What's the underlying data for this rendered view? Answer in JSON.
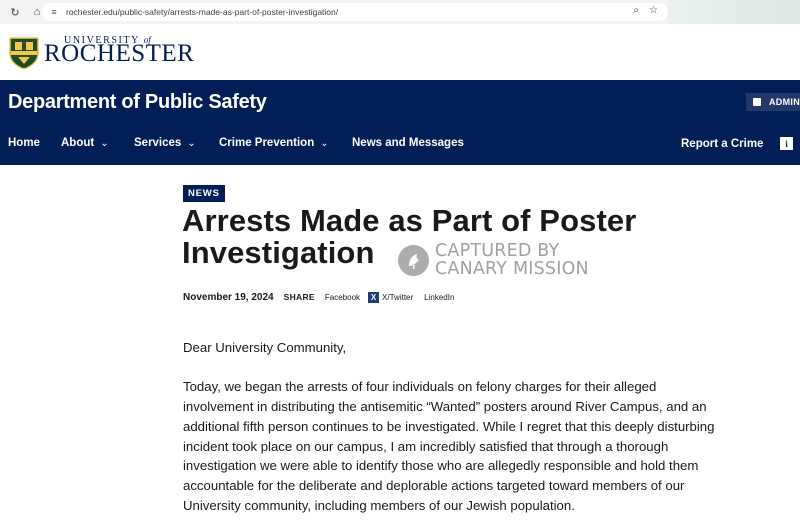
{
  "browser": {
    "url": "rochester.edu/public-safety/arrests-made-as-part-of-poster-investigation/"
  },
  "university": {
    "small": "UNIVERSITY",
    "of": "of",
    "big": "ROCHESTER"
  },
  "department": {
    "title": "Department of Public Safety",
    "admin_label": "ADMINI"
  },
  "nav": {
    "items": [
      {
        "label": "Home"
      },
      {
        "label": "About"
      },
      {
        "label": "Services"
      },
      {
        "label": "Crime Prevention"
      },
      {
        "label": "News and Messages"
      }
    ],
    "report_label": "Report a Crime"
  },
  "article": {
    "badge": "NEWS",
    "title": "Arrests Made as Part of Poster Investigation",
    "date": "November 19, 2024",
    "share_label": "SHARE",
    "social": {
      "facebook": "Facebook",
      "x": "X/Twitter",
      "linkedin": "LinkedIn"
    },
    "greeting": "Dear University Community,",
    "paragraph": "Today, we began the arrests of four individuals on felony charges for their alleged involvement in distributing the antisemitic “Wanted” posters around River Campus, and an additional fifth person continues to be investigated. While I regret that this deeply disturbing incident took place on our campus, I am incredibly satisfied that through a thorough investigation we were able to identify those who are allegedly responsible and hold them accountable for the deliberate and deplorable actions targeted toward members of our University community, including members of our Jewish population."
  },
  "watermark": {
    "line1": "CAPTURED BY",
    "line2": "CANARY MISSION"
  },
  "colors": {
    "brand_navy": "#021e56",
    "crest_gold": "#f2c94c",
    "crest_green": "#1f4d2b"
  }
}
